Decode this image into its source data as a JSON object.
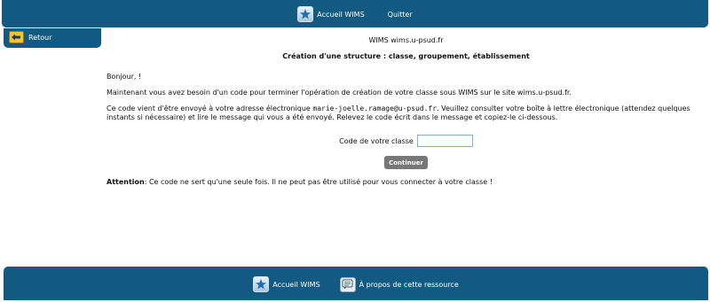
{
  "topbar": {
    "home_label": "Accueil WIMS",
    "quit_label": "Quitter"
  },
  "sidebar": {
    "back_label": "Retour"
  },
  "header": {
    "site_title": "WIMS wims.u-psud.fr",
    "page_title": "Création d'une structure : classe, groupement, établissement"
  },
  "content": {
    "greeting": "Bonjour, !",
    "intro": "Maintenant vous avez besoin d'un code pour terminer l'opération de création de votre classe sous WIMS sur le site wims.u-psud.fr.",
    "code_sent_prefix": "Ce code vient d'être envoyé à votre adresse électronique",
    "email": "marie-joelle.ramage@u-psud.fr",
    "code_sent_suffix": ". Veuillez consulter votre boîte à lettre électronique (attendez quelques instants si nécessaire) et lire le message qui vous a été envoyé. Relevez le code écrit dans le message et copiez-le ci-dessous."
  },
  "form": {
    "code_label": "Code de votre classe",
    "code_value": "",
    "submit_label": "Continuer"
  },
  "attention": {
    "label": "Attention",
    "text": ": Ce code ne sert qu'une seule fois. Il ne peut pas être utilisé pour vous connecter à votre classe !"
  },
  "footer": {
    "home_label": "Accueil WIMS",
    "about_label": "À propos de cette ressource"
  },
  "colors": {
    "bar": "#125a82",
    "button": "#777777",
    "back_icon": "#f2c531"
  },
  "icons": [
    "wims-logo-icon",
    "back-arrow-icon",
    "about-resource-icon"
  ]
}
